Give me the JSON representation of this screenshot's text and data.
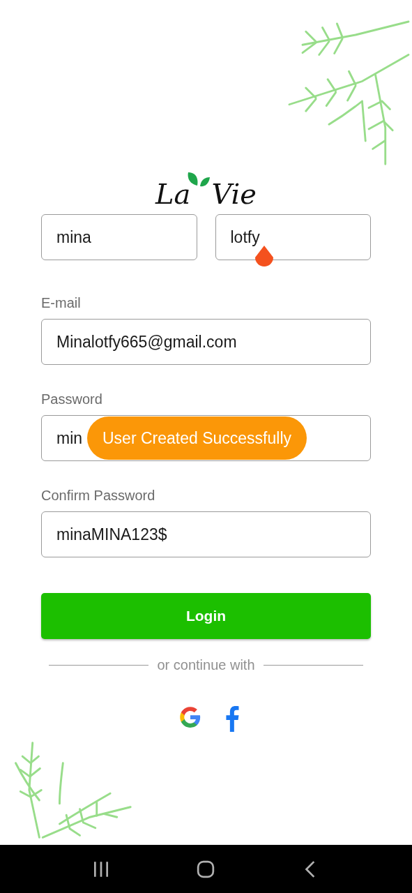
{
  "logo": {
    "first": "La",
    "second": "Vie"
  },
  "name_fields": [
    {
      "value": "mina",
      "focused": false
    },
    {
      "value": "lotfy",
      "focused": true
    }
  ],
  "fields": [
    {
      "label": "E-mail",
      "value": "Minalotfy665@gmail.com"
    },
    {
      "label": "Password",
      "value": "min"
    },
    {
      "label": "Confirm Password",
      "value": "minaMINA123$"
    }
  ],
  "toast": "User Created Successfully",
  "login_button": "Login",
  "divider_text": "or continue with"
}
